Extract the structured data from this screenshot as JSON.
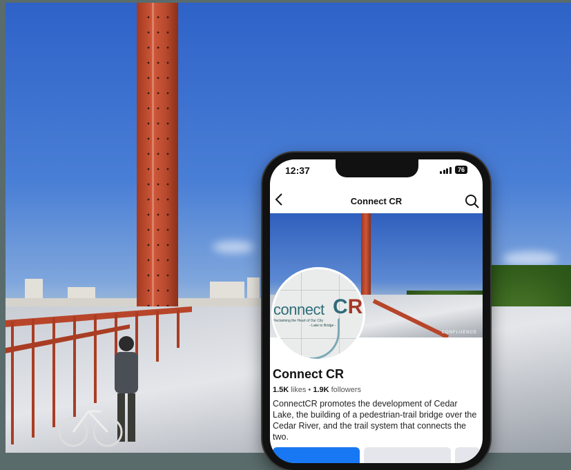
{
  "status_bar": {
    "time": "12:37",
    "battery": "76"
  },
  "nav": {
    "title": "Connect CR"
  },
  "cover": {
    "watermark": "CONFLUENCE"
  },
  "logo": {
    "word": "connect",
    "mark_c": "C",
    "mark_r": "R",
    "tagline": "Reclaiming the Heart of Our City",
    "tagline2": "- Lake to Bridge -"
  },
  "page": {
    "name": "Connect CR",
    "likes": "1.5K",
    "likes_label": "likes",
    "separator": "•",
    "followers": "1.9K",
    "followers_label": "followers",
    "about": "ConnectCR promotes the development of Cedar Lake, the building of a pedestrian-trail bridge over the Cedar River, and the trail system that connects the two."
  },
  "icons": {
    "back": "chevron-left-icon",
    "search": "search-icon"
  }
}
